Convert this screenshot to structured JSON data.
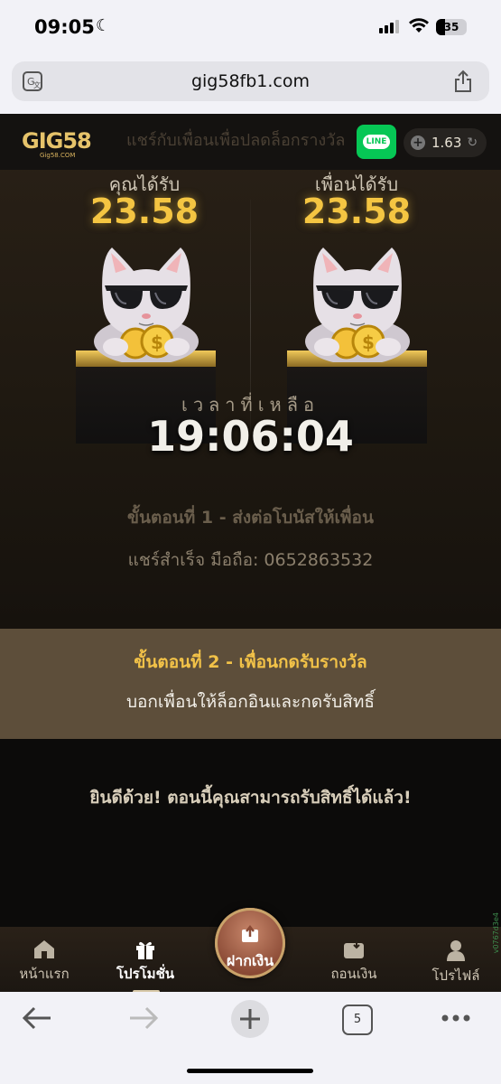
{
  "status_bar": {
    "time": "09:05",
    "battery": "35"
  },
  "browser": {
    "url": "gig58fb1.com",
    "tab_count": "5"
  },
  "header": {
    "logo_main": "GIG58",
    "logo_sub": "Gig58.COM",
    "title": "แชร์กับเพื่อนเพื่อปลดล็อกรางวัล",
    "line_label": "LINE",
    "balance": "1.63"
  },
  "reward": {
    "you_label": "คุณได้รับ",
    "you_value": "23.58",
    "friend_label": "เพื่อนได้รับ",
    "friend_value": "23.58"
  },
  "timer": {
    "label": "เวลาที่เหลือ",
    "value": "19:06:04"
  },
  "step1": {
    "title": "ขั้นตอนที่ 1 - ส่งต่อโบนัสให้เพื่อน",
    "text": "แชร์สำเร็จ มือถือ: 0652863532"
  },
  "step2": {
    "title": "ขั้นตอนที่ 2 - เพื่อนกดรับรางวัล",
    "text": "บอกเพื่อนให้ล็อกอินและกดรับสิทธิ์"
  },
  "congrats": "ยินดีด้วย! ตอนนี้คุณสามารถรับสิทธิ์ได้แล้ว!",
  "nav": {
    "home": "หน้าแรก",
    "promotion": "โปรโมชั่น",
    "deposit": "ฝากเงิน",
    "withdraw": "ถอนเงิน",
    "profile": "โปรไฟล์"
  },
  "side_text": "v0767d3e4"
}
